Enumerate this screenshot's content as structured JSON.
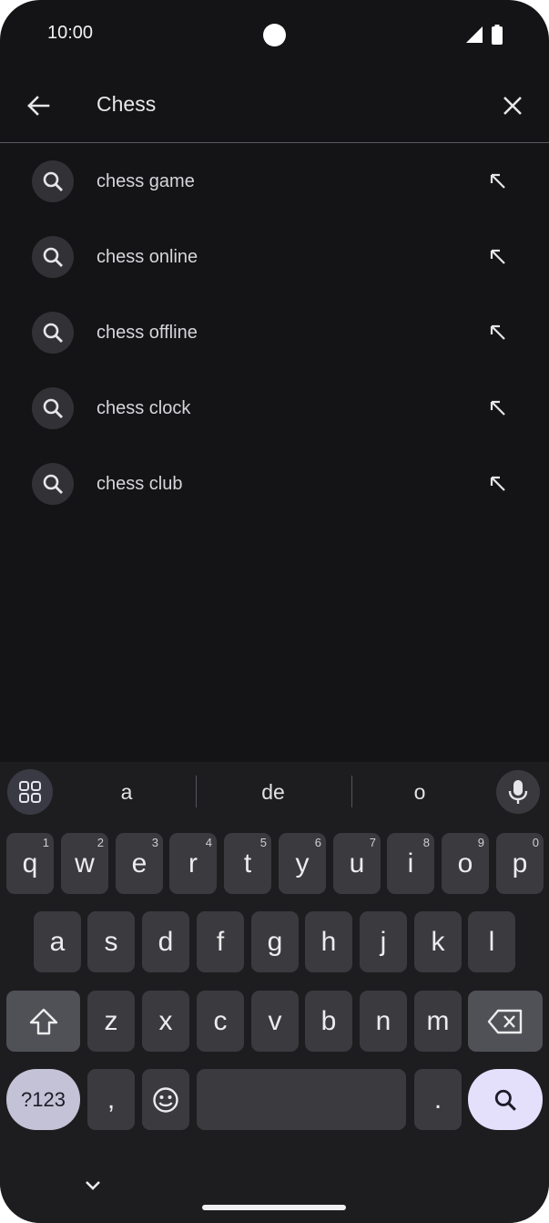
{
  "status_bar": {
    "time": "10:00",
    "icons": [
      "camera-dot",
      "signal-icon",
      "battery-icon"
    ]
  },
  "search": {
    "query": "Chess",
    "back_icon": "arrow-back-icon",
    "clear_icon": "close-icon"
  },
  "suggestions": [
    {
      "text": "chess game"
    },
    {
      "text": "chess online"
    },
    {
      "text": "chess offline"
    },
    {
      "text": "chess clock"
    },
    {
      "text": "chess club"
    }
  ],
  "keyboard": {
    "word_suggestions": [
      "a",
      "de",
      "o"
    ],
    "row1": [
      {
        "k": "q",
        "h": "1"
      },
      {
        "k": "w",
        "h": "2"
      },
      {
        "k": "e",
        "h": "3"
      },
      {
        "k": "r",
        "h": "4"
      },
      {
        "k": "t",
        "h": "5"
      },
      {
        "k": "y",
        "h": "6"
      },
      {
        "k": "u",
        "h": "7"
      },
      {
        "k": "i",
        "h": "8"
      },
      {
        "k": "o",
        "h": "9"
      },
      {
        "k": "p",
        "h": "0"
      }
    ],
    "row2": [
      "a",
      "s",
      "d",
      "f",
      "g",
      "h",
      "j",
      "k",
      "l"
    ],
    "row3": [
      "z",
      "x",
      "c",
      "v",
      "b",
      "n",
      "m"
    ],
    "symbols_label": "?123",
    "comma_label": ",",
    "period_label": ".",
    "colors": {
      "background": "#1d1d20",
      "key": "#3b3b3f",
      "accent": "#e4dffb"
    }
  }
}
